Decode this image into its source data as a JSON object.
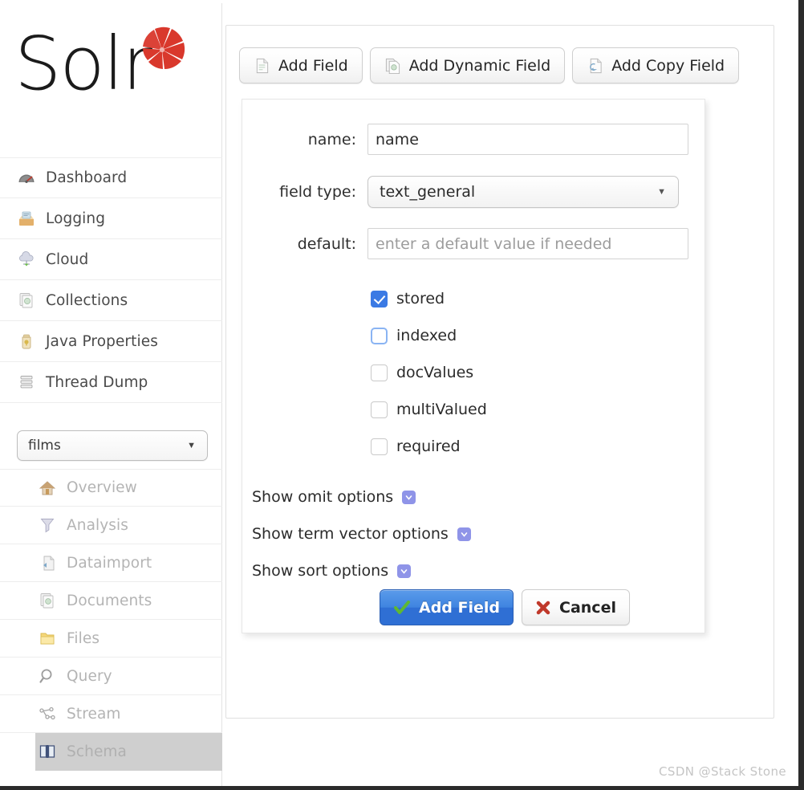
{
  "app": {
    "logo_text": "Solr",
    "watermark": "CSDN @Stack Stone"
  },
  "sidebar": {
    "main_nav": [
      {
        "label": "Dashboard",
        "icon": "dashboard-icon"
      },
      {
        "label": "Logging",
        "icon": "logging-icon"
      },
      {
        "label": "Cloud",
        "icon": "cloud-icon"
      },
      {
        "label": "Collections",
        "icon": "collections-icon"
      },
      {
        "label": "Java Properties",
        "icon": "java-properties-icon"
      },
      {
        "label": "Thread Dump",
        "icon": "thread-dump-icon"
      }
    ],
    "collection_select": {
      "value": "films",
      "caret": "▼"
    },
    "collection_nav": [
      {
        "label": "Overview",
        "icon": "home-icon",
        "active": false
      },
      {
        "label": "Analysis",
        "icon": "funnel-icon",
        "active": false
      },
      {
        "label": "Dataimport",
        "icon": "dataimport-icon",
        "active": false
      },
      {
        "label": "Documents",
        "icon": "documents-icon",
        "active": false
      },
      {
        "label": "Files",
        "icon": "folder-icon",
        "active": false
      },
      {
        "label": "Query",
        "icon": "magnifier-icon",
        "active": false
      },
      {
        "label": "Stream",
        "icon": "stream-icon",
        "active": false
      },
      {
        "label": "Schema",
        "icon": "book-icon",
        "active": true
      }
    ]
  },
  "toolbar": {
    "buttons": [
      {
        "label": "Add Field",
        "icon": "file-plain-icon"
      },
      {
        "label": "Add Dynamic Field",
        "icon": "file-dynamic-icon"
      },
      {
        "label": "Add Copy Field",
        "icon": "file-copy-icon"
      }
    ]
  },
  "form": {
    "name": {
      "label": "name:",
      "value": "name",
      "placeholder": ""
    },
    "field_type": {
      "label": "field type:",
      "value": "text_general",
      "caret": "▼"
    },
    "default": {
      "label": "default:",
      "value": "",
      "placeholder": "enter a default value if needed"
    },
    "checkboxes": [
      {
        "label": "stored",
        "checked": true,
        "focused": false
      },
      {
        "label": "indexed",
        "checked": false,
        "focused": true
      },
      {
        "label": "docValues",
        "checked": false,
        "focused": false
      },
      {
        "label": "multiValued",
        "checked": false,
        "focused": false
      },
      {
        "label": "required",
        "checked": false,
        "focused": false
      }
    ],
    "show_options": [
      {
        "label": "Show omit options"
      },
      {
        "label": "Show term vector options"
      },
      {
        "label": "Show sort options"
      }
    ],
    "actions": {
      "submit": {
        "label": "Add Field",
        "icon": "check-icon"
      },
      "cancel": {
        "label": "Cancel",
        "icon": "x-icon"
      }
    }
  },
  "colors": {
    "accent_blue": "#3b7ae4",
    "submit_blue": "#2f6fd4",
    "check_green": "#5fb832",
    "cancel_red": "#c0392b",
    "toggle_purple": "#8f94e8",
    "logo_red": "#d9382c",
    "active_row": "#cfcfcf"
  }
}
